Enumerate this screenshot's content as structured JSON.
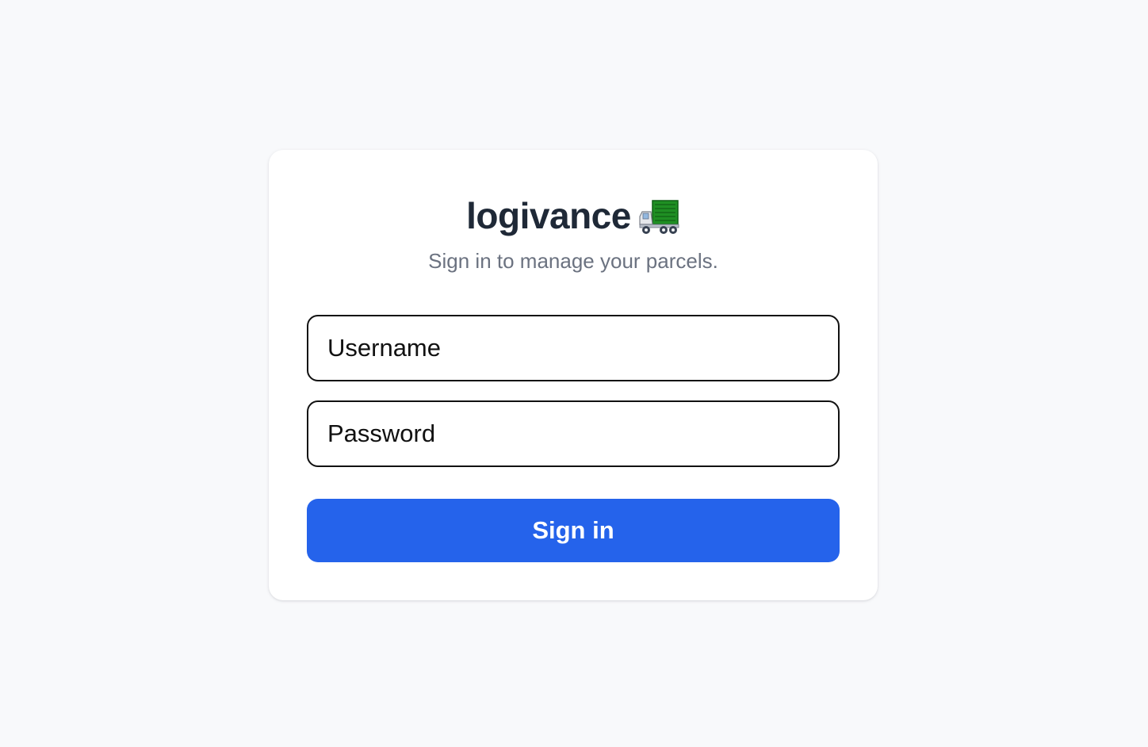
{
  "brand": {
    "name": "logivance",
    "icon": "delivery-truck-icon",
    "icon_color": "#2e8b2e"
  },
  "subtitle": "Sign in to manage your parcels.",
  "form": {
    "username_placeholder": "Username",
    "password_placeholder": "Password",
    "submit_label": "Sign in"
  },
  "colors": {
    "page_background": "#f8f9fb",
    "card_background": "#ffffff",
    "title": "#1f2937",
    "subtitle": "#6b7280",
    "primary_button": "#2563eb"
  }
}
